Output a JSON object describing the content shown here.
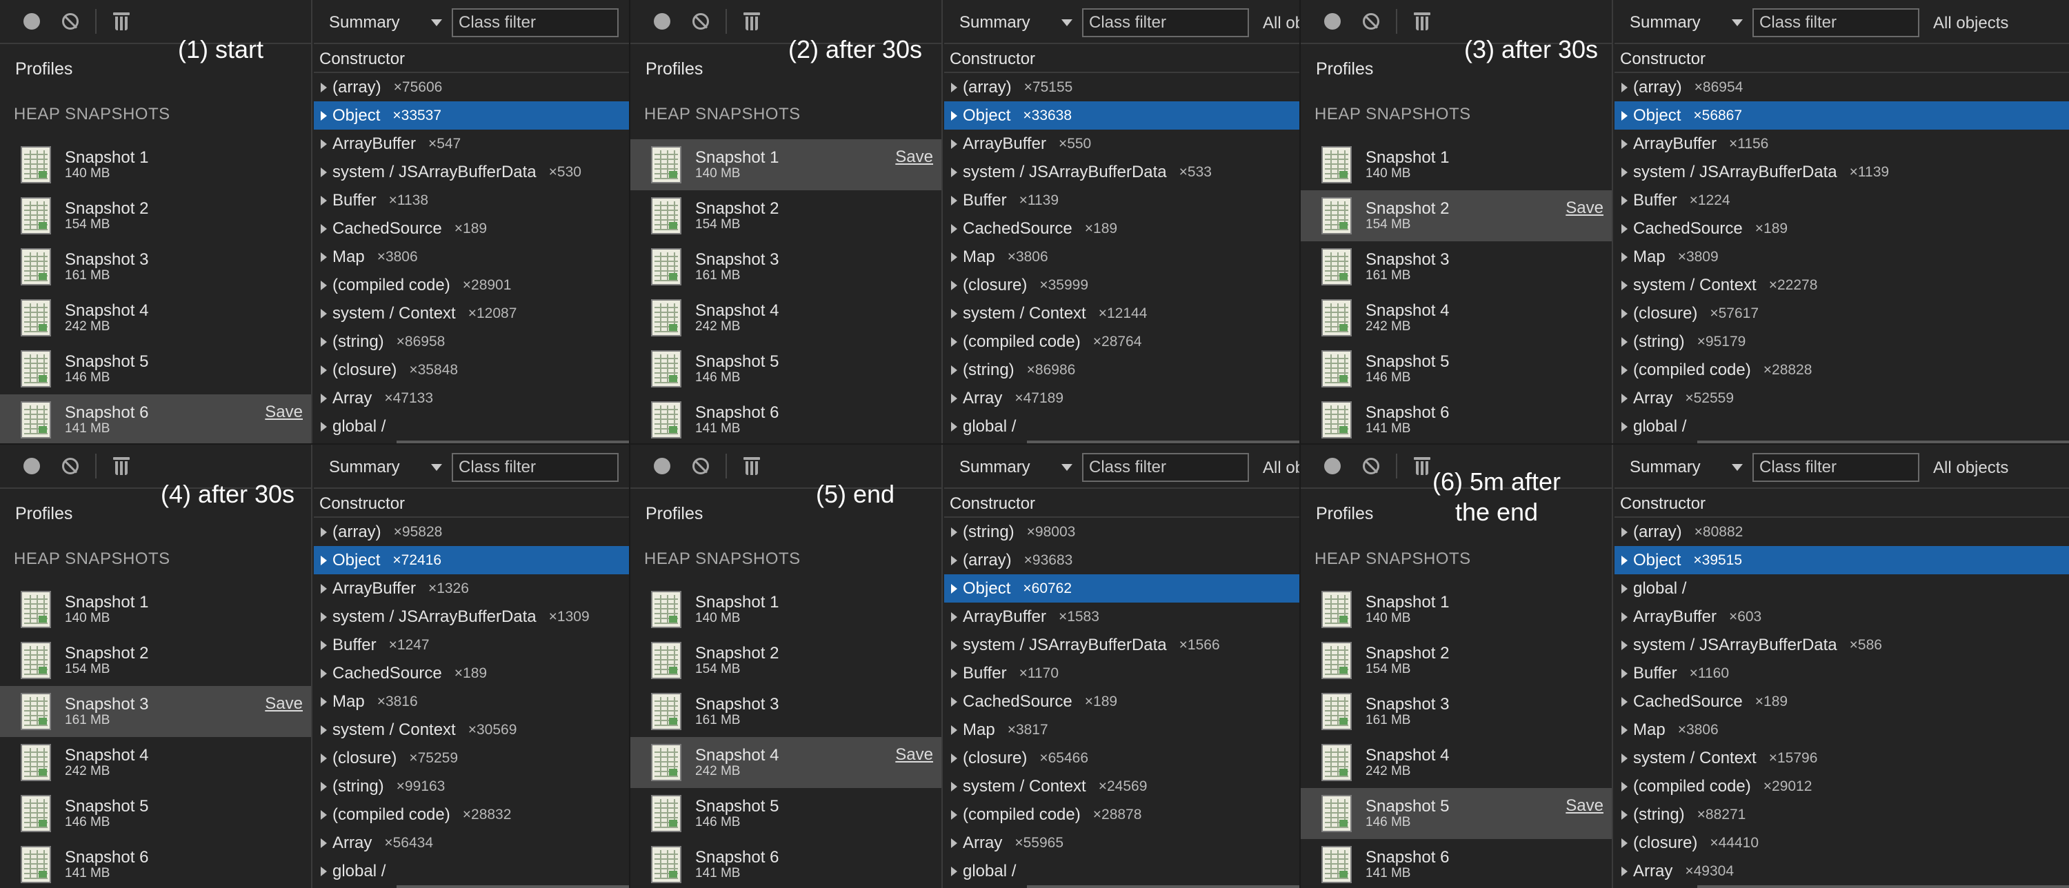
{
  "toolbar": {
    "summary_label": "Summary",
    "filter_placeholder": "Class filter",
    "all_objects_label": "All objects"
  },
  "sidebar": {
    "profiles_title": "Profiles",
    "heap_header": "HEAP SNAPSHOTS",
    "save_label": "Save"
  },
  "constructor_header": "Constructor",
  "panels": [
    {
      "label": "(1) start",
      "selected_snapshot": 6,
      "snapshots": [
        {
          "name": "Snapshot 1",
          "size": "140 MB"
        },
        {
          "name": "Snapshot 2",
          "size": "154 MB"
        },
        {
          "name": "Snapshot 3",
          "size": "161 MB"
        },
        {
          "name": "Snapshot 4",
          "size": "242 MB"
        },
        {
          "name": "Snapshot 5",
          "size": "146 MB"
        },
        {
          "name": "Snapshot 6",
          "size": "141 MB"
        }
      ],
      "rows": [
        {
          "name": "(array)",
          "count": "×75606"
        },
        {
          "name": "Object",
          "count": "×33537",
          "selected": true
        },
        {
          "name": "ArrayBuffer",
          "count": "×547"
        },
        {
          "name": "system / JSArrayBufferData",
          "count": "×530"
        },
        {
          "name": "Buffer",
          "count": "×1138"
        },
        {
          "name": "CachedSource",
          "count": "×189"
        },
        {
          "name": "Map",
          "count": "×3806"
        },
        {
          "name": "(compiled code)",
          "count": "×28901"
        },
        {
          "name": "system / Context",
          "count": "×12087"
        },
        {
          "name": "(string)",
          "count": "×86958"
        },
        {
          "name": "(closure)",
          "count": "×35848"
        },
        {
          "name": "Array",
          "count": "×47133"
        },
        {
          "name": "global /",
          "count": ""
        }
      ]
    },
    {
      "label": "(2) after 30s",
      "selected_snapshot": 1,
      "snapshots": [
        {
          "name": "Snapshot 1",
          "size": "140 MB"
        },
        {
          "name": "Snapshot 2",
          "size": "154 MB"
        },
        {
          "name": "Snapshot 3",
          "size": "161 MB"
        },
        {
          "name": "Snapshot 4",
          "size": "242 MB"
        },
        {
          "name": "Snapshot 5",
          "size": "146 MB"
        },
        {
          "name": "Snapshot 6",
          "size": "141 MB"
        }
      ],
      "rows": [
        {
          "name": "(array)",
          "count": "×75155"
        },
        {
          "name": "Object",
          "count": "×33638",
          "selected": true
        },
        {
          "name": "ArrayBuffer",
          "count": "×550"
        },
        {
          "name": "system / JSArrayBufferData",
          "count": "×533"
        },
        {
          "name": "Buffer",
          "count": "×1139"
        },
        {
          "name": "CachedSource",
          "count": "×189"
        },
        {
          "name": "Map",
          "count": "×3806"
        },
        {
          "name": "(closure)",
          "count": "×35999"
        },
        {
          "name": "system / Context",
          "count": "×12144"
        },
        {
          "name": "(compiled code)",
          "count": "×28764"
        },
        {
          "name": "(string)",
          "count": "×86986"
        },
        {
          "name": "Array",
          "count": "×47189"
        },
        {
          "name": "global /",
          "count": ""
        }
      ]
    },
    {
      "label": "(3) after 30s",
      "selected_snapshot": 2,
      "snapshots": [
        {
          "name": "Snapshot 1",
          "size": "140 MB"
        },
        {
          "name": "Snapshot 2",
          "size": "154 MB"
        },
        {
          "name": "Snapshot 3",
          "size": "161 MB"
        },
        {
          "name": "Snapshot 4",
          "size": "242 MB"
        },
        {
          "name": "Snapshot 5",
          "size": "146 MB"
        },
        {
          "name": "Snapshot 6",
          "size": "141 MB"
        }
      ],
      "rows": [
        {
          "name": "(array)",
          "count": "×86954"
        },
        {
          "name": "Object",
          "count": "×56867",
          "selected": true
        },
        {
          "name": "ArrayBuffer",
          "count": "×1156"
        },
        {
          "name": "system / JSArrayBufferData",
          "count": "×1139"
        },
        {
          "name": "Buffer",
          "count": "×1224"
        },
        {
          "name": "CachedSource",
          "count": "×189"
        },
        {
          "name": "Map",
          "count": "×3809"
        },
        {
          "name": "system / Context",
          "count": "×22278"
        },
        {
          "name": "(closure)",
          "count": "×57617"
        },
        {
          "name": "(string)",
          "count": "×95179"
        },
        {
          "name": "(compiled code)",
          "count": "×28828"
        },
        {
          "name": "Array",
          "count": "×52559"
        },
        {
          "name": "global /",
          "count": ""
        }
      ]
    },
    {
      "label": "(4) after 30s",
      "selected_snapshot": 3,
      "snapshots": [
        {
          "name": "Snapshot 1",
          "size": "140 MB"
        },
        {
          "name": "Snapshot 2",
          "size": "154 MB"
        },
        {
          "name": "Snapshot 3",
          "size": "161 MB"
        },
        {
          "name": "Snapshot 4",
          "size": "242 MB"
        },
        {
          "name": "Snapshot 5",
          "size": "146 MB"
        },
        {
          "name": "Snapshot 6",
          "size": "141 MB"
        }
      ],
      "rows": [
        {
          "name": "(array)",
          "count": "×95828"
        },
        {
          "name": "Object",
          "count": "×72416",
          "selected": true
        },
        {
          "name": "ArrayBuffer",
          "count": "×1326"
        },
        {
          "name": "system / JSArrayBufferData",
          "count": "×1309"
        },
        {
          "name": "Buffer",
          "count": "×1247"
        },
        {
          "name": "CachedSource",
          "count": "×189"
        },
        {
          "name": "Map",
          "count": "×3816"
        },
        {
          "name": "system / Context",
          "count": "×30569"
        },
        {
          "name": "(closure)",
          "count": "×75259"
        },
        {
          "name": "(string)",
          "count": "×99163"
        },
        {
          "name": "(compiled code)",
          "count": "×28832"
        },
        {
          "name": "Array",
          "count": "×56434"
        },
        {
          "name": "global /",
          "count": ""
        }
      ]
    },
    {
      "label": "(5) end",
      "selected_snapshot": 4,
      "snapshots": [
        {
          "name": "Snapshot 1",
          "size": "140 MB"
        },
        {
          "name": "Snapshot 2",
          "size": "154 MB"
        },
        {
          "name": "Snapshot 3",
          "size": "161 MB"
        },
        {
          "name": "Snapshot 4",
          "size": "242 MB"
        },
        {
          "name": "Snapshot 5",
          "size": "146 MB"
        },
        {
          "name": "Snapshot 6",
          "size": "141 MB"
        }
      ],
      "rows": [
        {
          "name": "(string)",
          "count": "×98003"
        },
        {
          "name": "(array)",
          "count": "×93683"
        },
        {
          "name": "Object",
          "count": "×60762",
          "selected": true
        },
        {
          "name": "ArrayBuffer",
          "count": "×1583"
        },
        {
          "name": "system / JSArrayBufferData",
          "count": "×1566"
        },
        {
          "name": "Buffer",
          "count": "×1170"
        },
        {
          "name": "CachedSource",
          "count": "×189"
        },
        {
          "name": "Map",
          "count": "×3817"
        },
        {
          "name": "(closure)",
          "count": "×65466"
        },
        {
          "name": "system / Context",
          "count": "×24569"
        },
        {
          "name": "(compiled code)",
          "count": "×28878"
        },
        {
          "name": "Array",
          "count": "×55965"
        },
        {
          "name": "global /",
          "count": ""
        }
      ]
    },
    {
      "label": "(6) 5m after the end",
      "selected_snapshot": 5,
      "snapshots": [
        {
          "name": "Snapshot 1",
          "size": "140 MB"
        },
        {
          "name": "Snapshot 2",
          "size": "154 MB"
        },
        {
          "name": "Snapshot 3",
          "size": "161 MB"
        },
        {
          "name": "Snapshot 4",
          "size": "242 MB"
        },
        {
          "name": "Snapshot 5",
          "size": "146 MB"
        },
        {
          "name": "Snapshot 6",
          "size": "141 MB"
        }
      ],
      "rows": [
        {
          "name": "(array)",
          "count": "×80882"
        },
        {
          "name": "Object",
          "count": "×39515",
          "selected": true
        },
        {
          "name": "global /",
          "count": ""
        },
        {
          "name": "ArrayBuffer",
          "count": "×603"
        },
        {
          "name": "system / JSArrayBufferData",
          "count": "×586"
        },
        {
          "name": "Buffer",
          "count": "×1160"
        },
        {
          "name": "CachedSource",
          "count": "×189"
        },
        {
          "name": "Map",
          "count": "×3806"
        },
        {
          "name": "system / Context",
          "count": "×15796"
        },
        {
          "name": "(compiled code)",
          "count": "×29012"
        },
        {
          "name": "(string)",
          "count": "×88271"
        },
        {
          "name": "(closure)",
          "count": "×44410"
        },
        {
          "name": "Array",
          "count": "×49304"
        }
      ]
    }
  ]
}
